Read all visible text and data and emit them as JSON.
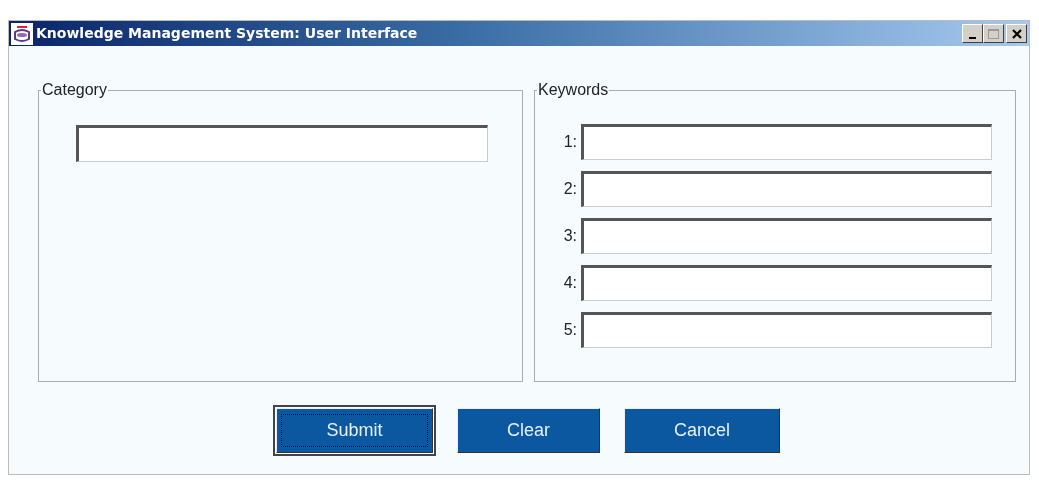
{
  "window": {
    "title": "Knowledge Management System: User Interface"
  },
  "category": {
    "legend": "Category"
  },
  "keywords": {
    "legend": "Keywords",
    "fields": [
      {
        "label": "1:"
      },
      {
        "label": "2:"
      },
      {
        "label": "3:"
      },
      {
        "label": "4:"
      },
      {
        "label": "5:"
      }
    ]
  },
  "buttons": [
    {
      "label": "Submit",
      "focused": true
    },
    {
      "label": "Clear",
      "focused": false
    },
    {
      "label": "Cancel",
      "focused": false
    }
  ]
}
